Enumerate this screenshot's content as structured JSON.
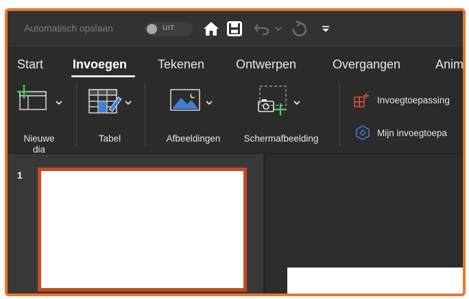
{
  "qat": {
    "title": "Automatisch opslaan",
    "toggle_label": "UIT",
    "icons": [
      "home-icon",
      "save-icon",
      "undo-icon",
      "chevron-down-icon",
      "redo-icon",
      "customize-icon"
    ]
  },
  "tabs": [
    {
      "label": "Start"
    },
    {
      "label": "Invoegen",
      "active": true
    },
    {
      "label": "Tekenen"
    },
    {
      "label": "Ontwerpen"
    },
    {
      "label": "Overgangen"
    },
    {
      "label": "Anim"
    }
  ],
  "ribbon": {
    "new_slide": {
      "line1": "Nieuwe",
      "line2": "dia"
    },
    "table": "Tabel",
    "pictures": "Afbeeldingen",
    "screenshot": "Schermafbeelding",
    "addins": "Invoegtoepassing",
    "my_addins": "Mijn invoegtoepa"
  },
  "slides": {
    "number": "1"
  },
  "colors": {
    "accent": "#e8772e",
    "selection": "#c94a22",
    "background": "#2b2b2b"
  }
}
